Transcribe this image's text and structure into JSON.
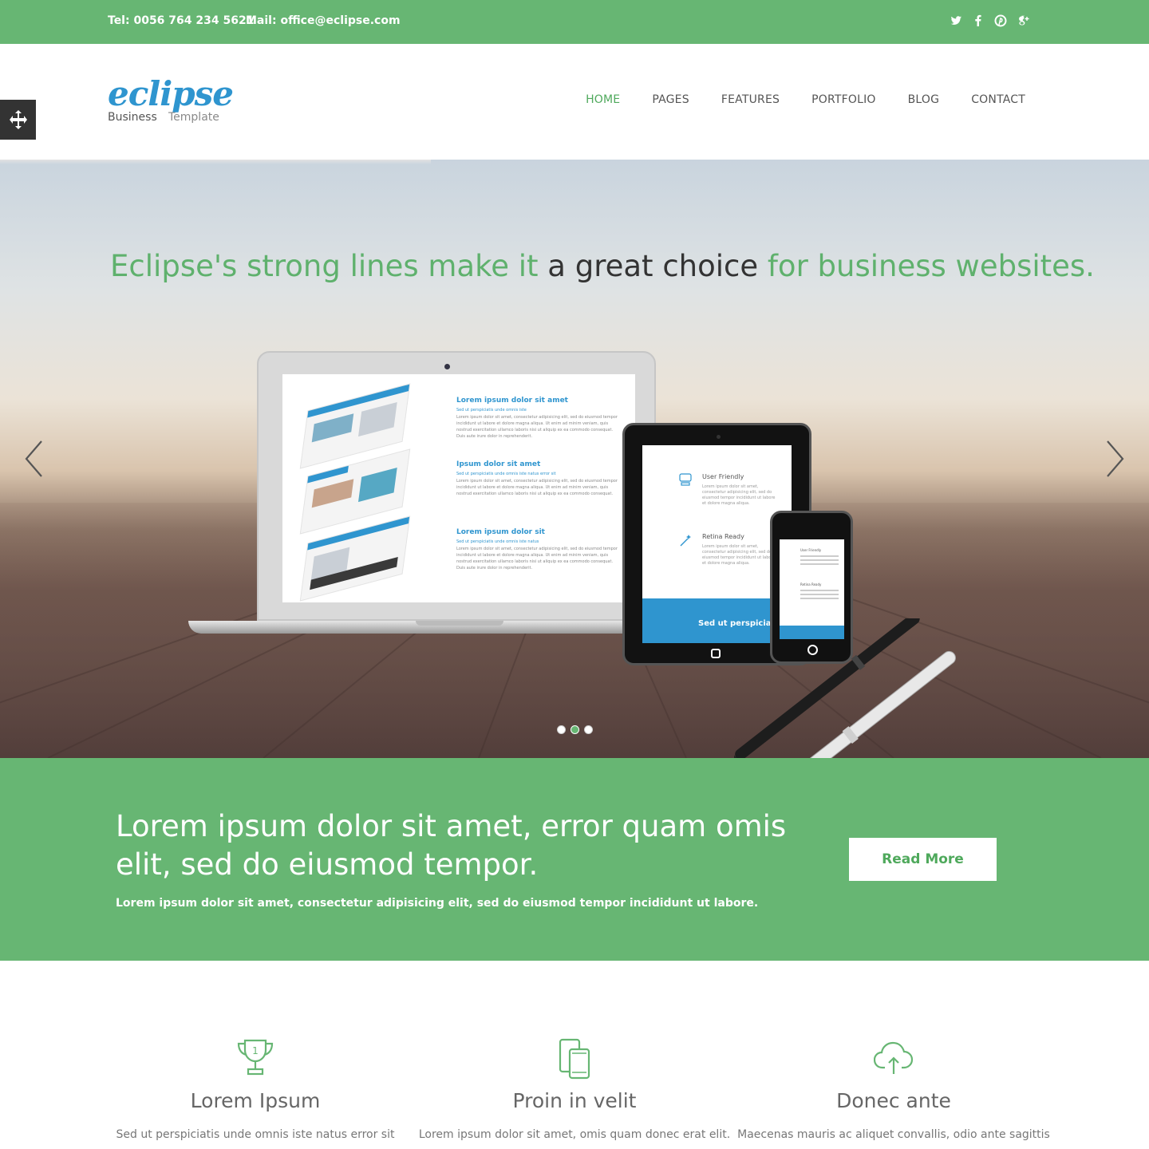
{
  "topbar": {
    "tel": "Tel: 0056 764 234 5621",
    "mail": "Mail: office@eclipse.com",
    "social": [
      "twitter-icon",
      "facebook-icon",
      "pinterest-icon",
      "google-plus-icon"
    ]
  },
  "logo": {
    "word": "eclipse",
    "sub1": "Business",
    "sub2": "Template"
  },
  "nav": {
    "items": [
      "HOME",
      "PAGES",
      "FEATURES",
      "PORTFOLIO",
      "BLOG",
      "CONTACT"
    ],
    "active": "HOME"
  },
  "hero": {
    "title_part1": "Eclipse's strong lines make it ",
    "title_part2": "a great choice",
    "title_part3": " for business websites.",
    "slides_total": 3,
    "slide_active": 2,
    "laptop": {
      "blocks": [
        {
          "heading": "Lorem ipsum dolor sit amet",
          "sub": "Sed ut perspiciatis unde omnis iste",
          "body": "Lorem ipsum dolor sit amet, consectetur adipisicing elit, sed do eiusmod tempor incididunt ut labore et dolore magna aliqua. Ut enim ad minim veniam, quis nostrud exercitation ullamco laboris nisi ut aliquip ex ea commodo consequat. Duis aute irure dolor in reprehenderit."
        },
        {
          "heading": "Ipsum dolor sit amet",
          "sub": "Sed ut perspiciatis unde omnis iste natus error sit",
          "body": "Lorem ipsum dolor sit amet, consectetur adipisicing elit, sed do eiusmod tempor incididunt ut labore et dolore magna aliqua. Ut enim ad minim veniam, quis nostrud exercitation ullamco laboris nisi ut aliquip ex ea commodo consequat."
        },
        {
          "heading": "Lorem ipsum dolor sit",
          "sub": "Sed ut perspiciatis unde omnis iste natus",
          "body": "Lorem ipsum dolor sit amet, consectetur adipisicing elit, sed do eiusmod tempor incididunt ut labore et dolore magna aliqua. Ut enim ad minim veniam, quis nostrud exercitation ullamco laboris nisi ut aliquip ex ea commodo consequat. Duis aute irure dolor in reprehenderit."
        }
      ]
    },
    "tablet": {
      "features": [
        {
          "title": "User Friendly",
          "body": "Lorem ipsum dolor sit amet, consectetur adipisicing elit, sed do eiusmod tempor incididunt ut labore et dolore magna aliqua."
        },
        {
          "title": "Retina Ready",
          "body": "Lorem ipsum dolor sit amet, consectetur adipisicing elit, sed do eiusmod tempor incididunt ut labore et dolore magna aliqua."
        }
      ],
      "band": "Sed ut perspiciatis"
    },
    "phone": {
      "features": [
        "User Friendly",
        "Retina Ready"
      ]
    }
  },
  "cta": {
    "heading": "Lorem ipsum dolor sit amet, error quam omis elit, sed do eiusmod tempor.",
    "text": "Lorem ipsum dolor sit amet, consectetur adipisicing elit, sed do eiusmod tempor incididunt ut labore.",
    "button": "Read More"
  },
  "features": [
    {
      "icon": "trophy-icon",
      "title": "Lorem Ipsum",
      "text": "Sed ut perspiciatis unde omnis iste natus error sit"
    },
    {
      "icon": "devices-icon",
      "title": "Proin in velit",
      "text": "Lorem ipsum dolor sit amet, omis quam donec erat elit."
    },
    {
      "icon": "cloud-upload-icon",
      "title": "Donec ante",
      "text": "Maecenas mauris ac aliquet convallis, odio ante sagittis"
    }
  ],
  "colors": {
    "green": "#67b673",
    "blue": "#2f95cf",
    "dark": "#333333"
  }
}
